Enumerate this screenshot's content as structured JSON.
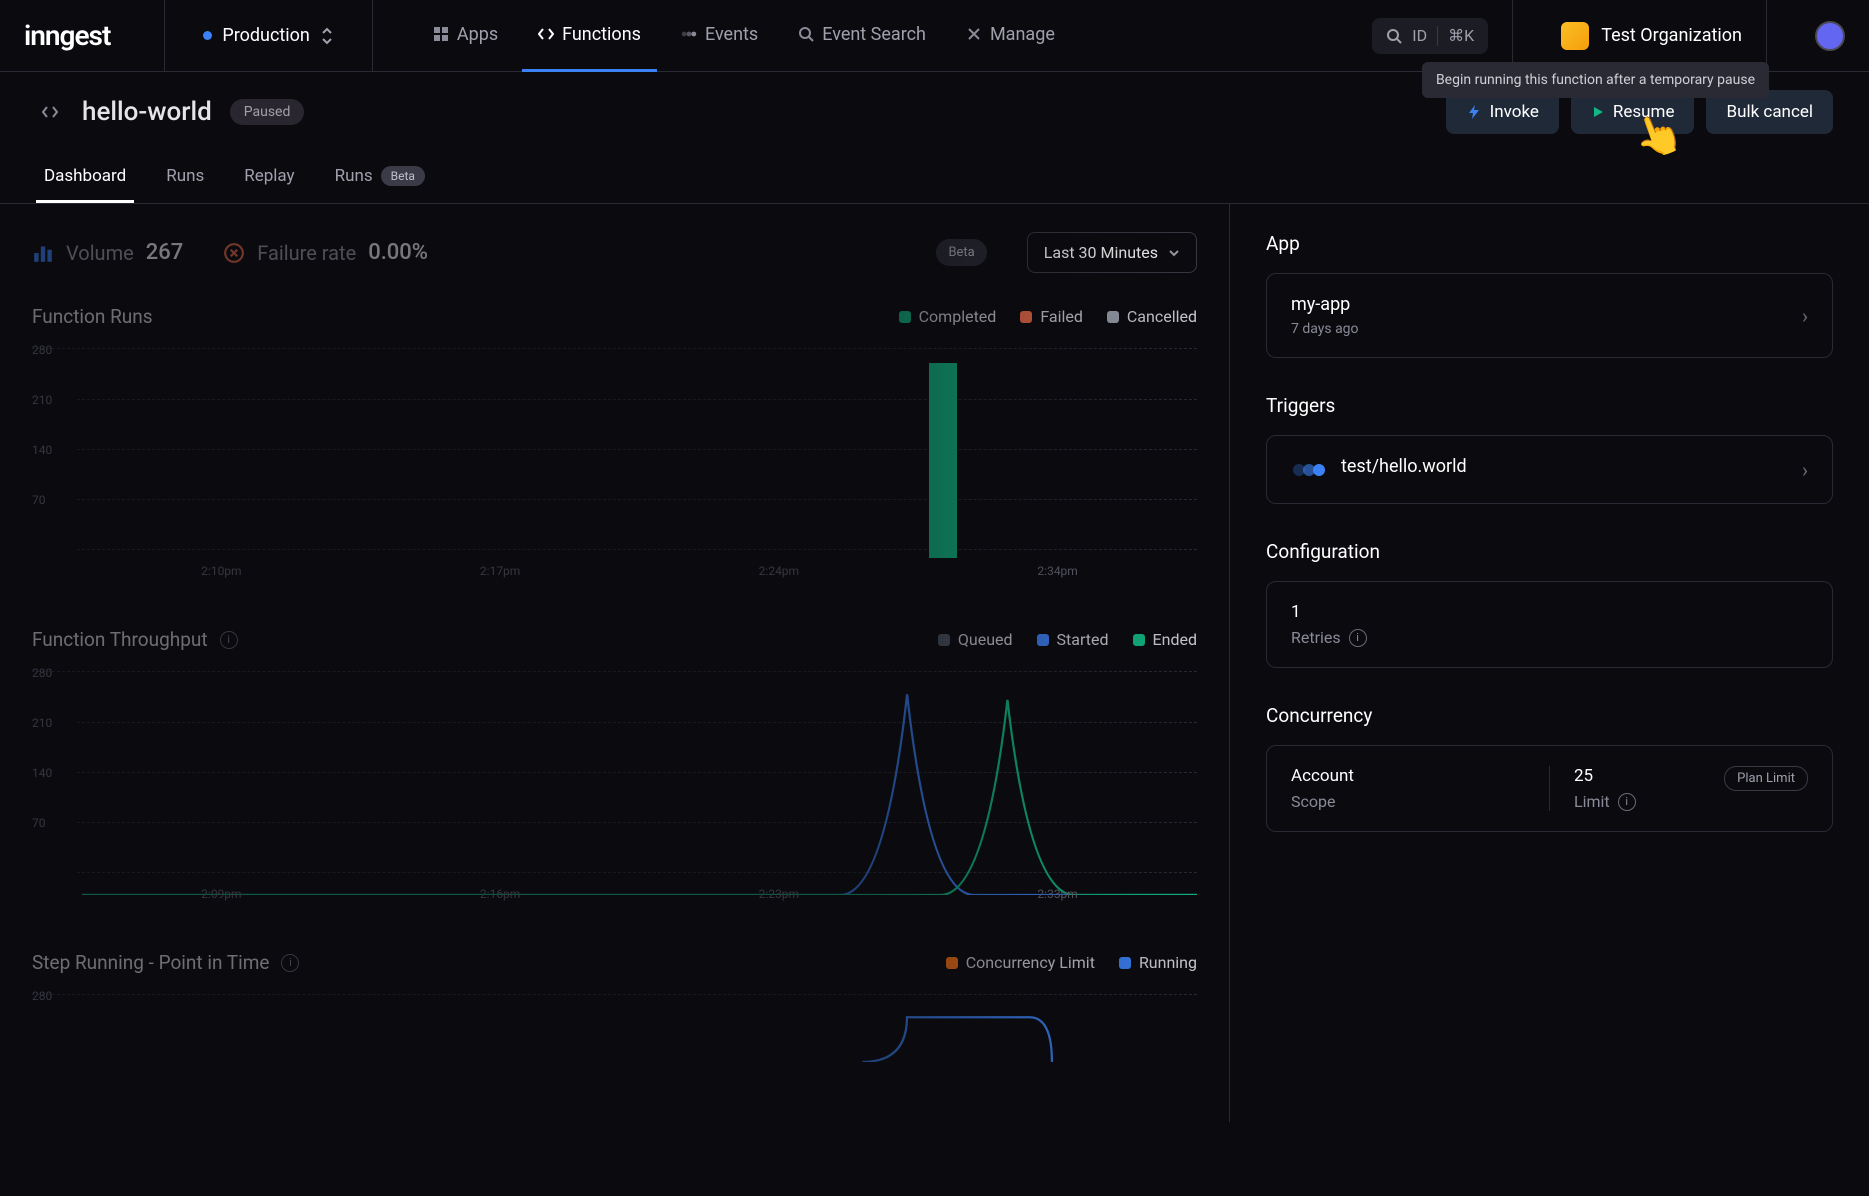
{
  "brand": "inngest",
  "env": "Production",
  "nav": {
    "apps": "Apps",
    "functions": "Functions",
    "events": "Events",
    "event_search": "Event Search",
    "manage": "Manage"
  },
  "search": {
    "label": "ID",
    "kbd": "⌘K"
  },
  "org": "Test Organization",
  "function": {
    "name": "hello-world",
    "status": "Paused"
  },
  "tooltip": "Begin running this function after a temporary pause",
  "actions": {
    "invoke": "Invoke",
    "resume": "Resume",
    "bulk_cancel": "Bulk cancel"
  },
  "tabs": {
    "dashboard": "Dashboard",
    "runs": "Runs",
    "replay": "Replay",
    "runs_beta": "Runs",
    "beta": "Beta"
  },
  "stats": {
    "volume_label": "Volume",
    "volume_value": "267",
    "failure_label": "Failure rate",
    "failure_value": "0.00%",
    "beta": "Beta",
    "timerange": "Last 30 Minutes"
  },
  "chart1": {
    "title": "Function Runs",
    "legend": {
      "completed": "Completed",
      "failed": "Failed",
      "cancelled": "Cancelled"
    }
  },
  "chart2": {
    "title": "Function Throughput",
    "legend": {
      "queued": "Queued",
      "started": "Started",
      "ended": "Ended"
    }
  },
  "chart3": {
    "title": "Step Running - Point in Time",
    "legend": {
      "limit": "Concurrency Limit",
      "running": "Running"
    }
  },
  "right": {
    "app_section": "App",
    "app_name": "my-app",
    "app_time": "7 days ago",
    "triggers_section": "Triggers",
    "trigger_name": "test/hello.world",
    "config_section": "Configuration",
    "retries_val": "1",
    "retries_label": "Retries",
    "concurrency_section": "Concurrency",
    "account_val": "Account",
    "scope_label": "Scope",
    "limit_val": "25",
    "limit_label": "Limit",
    "plan_limit": "Plan Limit"
  },
  "chart_data": [
    {
      "type": "bar",
      "title": "Function Runs",
      "ylabel": "",
      "ylim": [
        0,
        280
      ],
      "y_ticks": [
        70,
        140,
        210,
        280
      ],
      "x_ticks": [
        "2:10pm",
        "2:17pm",
        "2:24pm",
        "2:34pm"
      ],
      "series": [
        {
          "name": "Completed",
          "color": "#10b981",
          "values": [
            0,
            0,
            0,
            0,
            0,
            0,
            0,
            0,
            0,
            0,
            0,
            0,
            0,
            267,
            0,
            0,
            0,
            0
          ]
        },
        {
          "name": "Failed",
          "color": "#ef6b4a",
          "values": [
            0,
            0,
            0,
            0,
            0,
            0,
            0,
            0,
            0,
            0,
            0,
            0,
            0,
            0,
            0,
            0,
            0,
            0
          ]
        },
        {
          "name": "Cancelled",
          "color": "#9ca3af",
          "values": [
            0,
            0,
            0,
            0,
            0,
            0,
            0,
            0,
            0,
            0,
            0,
            0,
            0,
            0,
            0,
            0,
            0,
            0
          ]
        }
      ]
    },
    {
      "type": "line",
      "title": "Function Throughput",
      "ylim": [
        0,
        280
      ],
      "y_ticks": [
        70,
        140,
        210,
        280
      ],
      "x_ticks": [
        "2:09pm",
        "2:16pm",
        "2:23pm",
        "2:33pm"
      ],
      "series": [
        {
          "name": "Queued",
          "color": "#4b5563",
          "values": [
            0,
            0,
            0,
            0,
            0,
            0,
            0,
            0,
            0,
            0,
            0,
            0,
            0,
            0,
            0,
            0,
            0,
            0
          ]
        },
        {
          "name": "Started",
          "color": "#3b82f6",
          "values": [
            0,
            0,
            0,
            0,
            0,
            0,
            0,
            0,
            0,
            0,
            0,
            20,
            265,
            20,
            0,
            0,
            0,
            0
          ]
        },
        {
          "name": "Ended",
          "color": "#10b981",
          "values": [
            0,
            0,
            0,
            0,
            0,
            0,
            0,
            0,
            0,
            0,
            0,
            0,
            0,
            20,
            260,
            20,
            0,
            0
          ]
        }
      ]
    },
    {
      "type": "line",
      "title": "Step Running - Point in Time",
      "ylim": [
        0,
        280
      ],
      "y_ticks": [
        280
      ],
      "x_ticks": [],
      "series": [
        {
          "name": "Concurrency Limit",
          "color": "#f97316",
          "values": []
        },
        {
          "name": "Running",
          "color": "#3b82f6",
          "values": []
        }
      ]
    }
  ]
}
